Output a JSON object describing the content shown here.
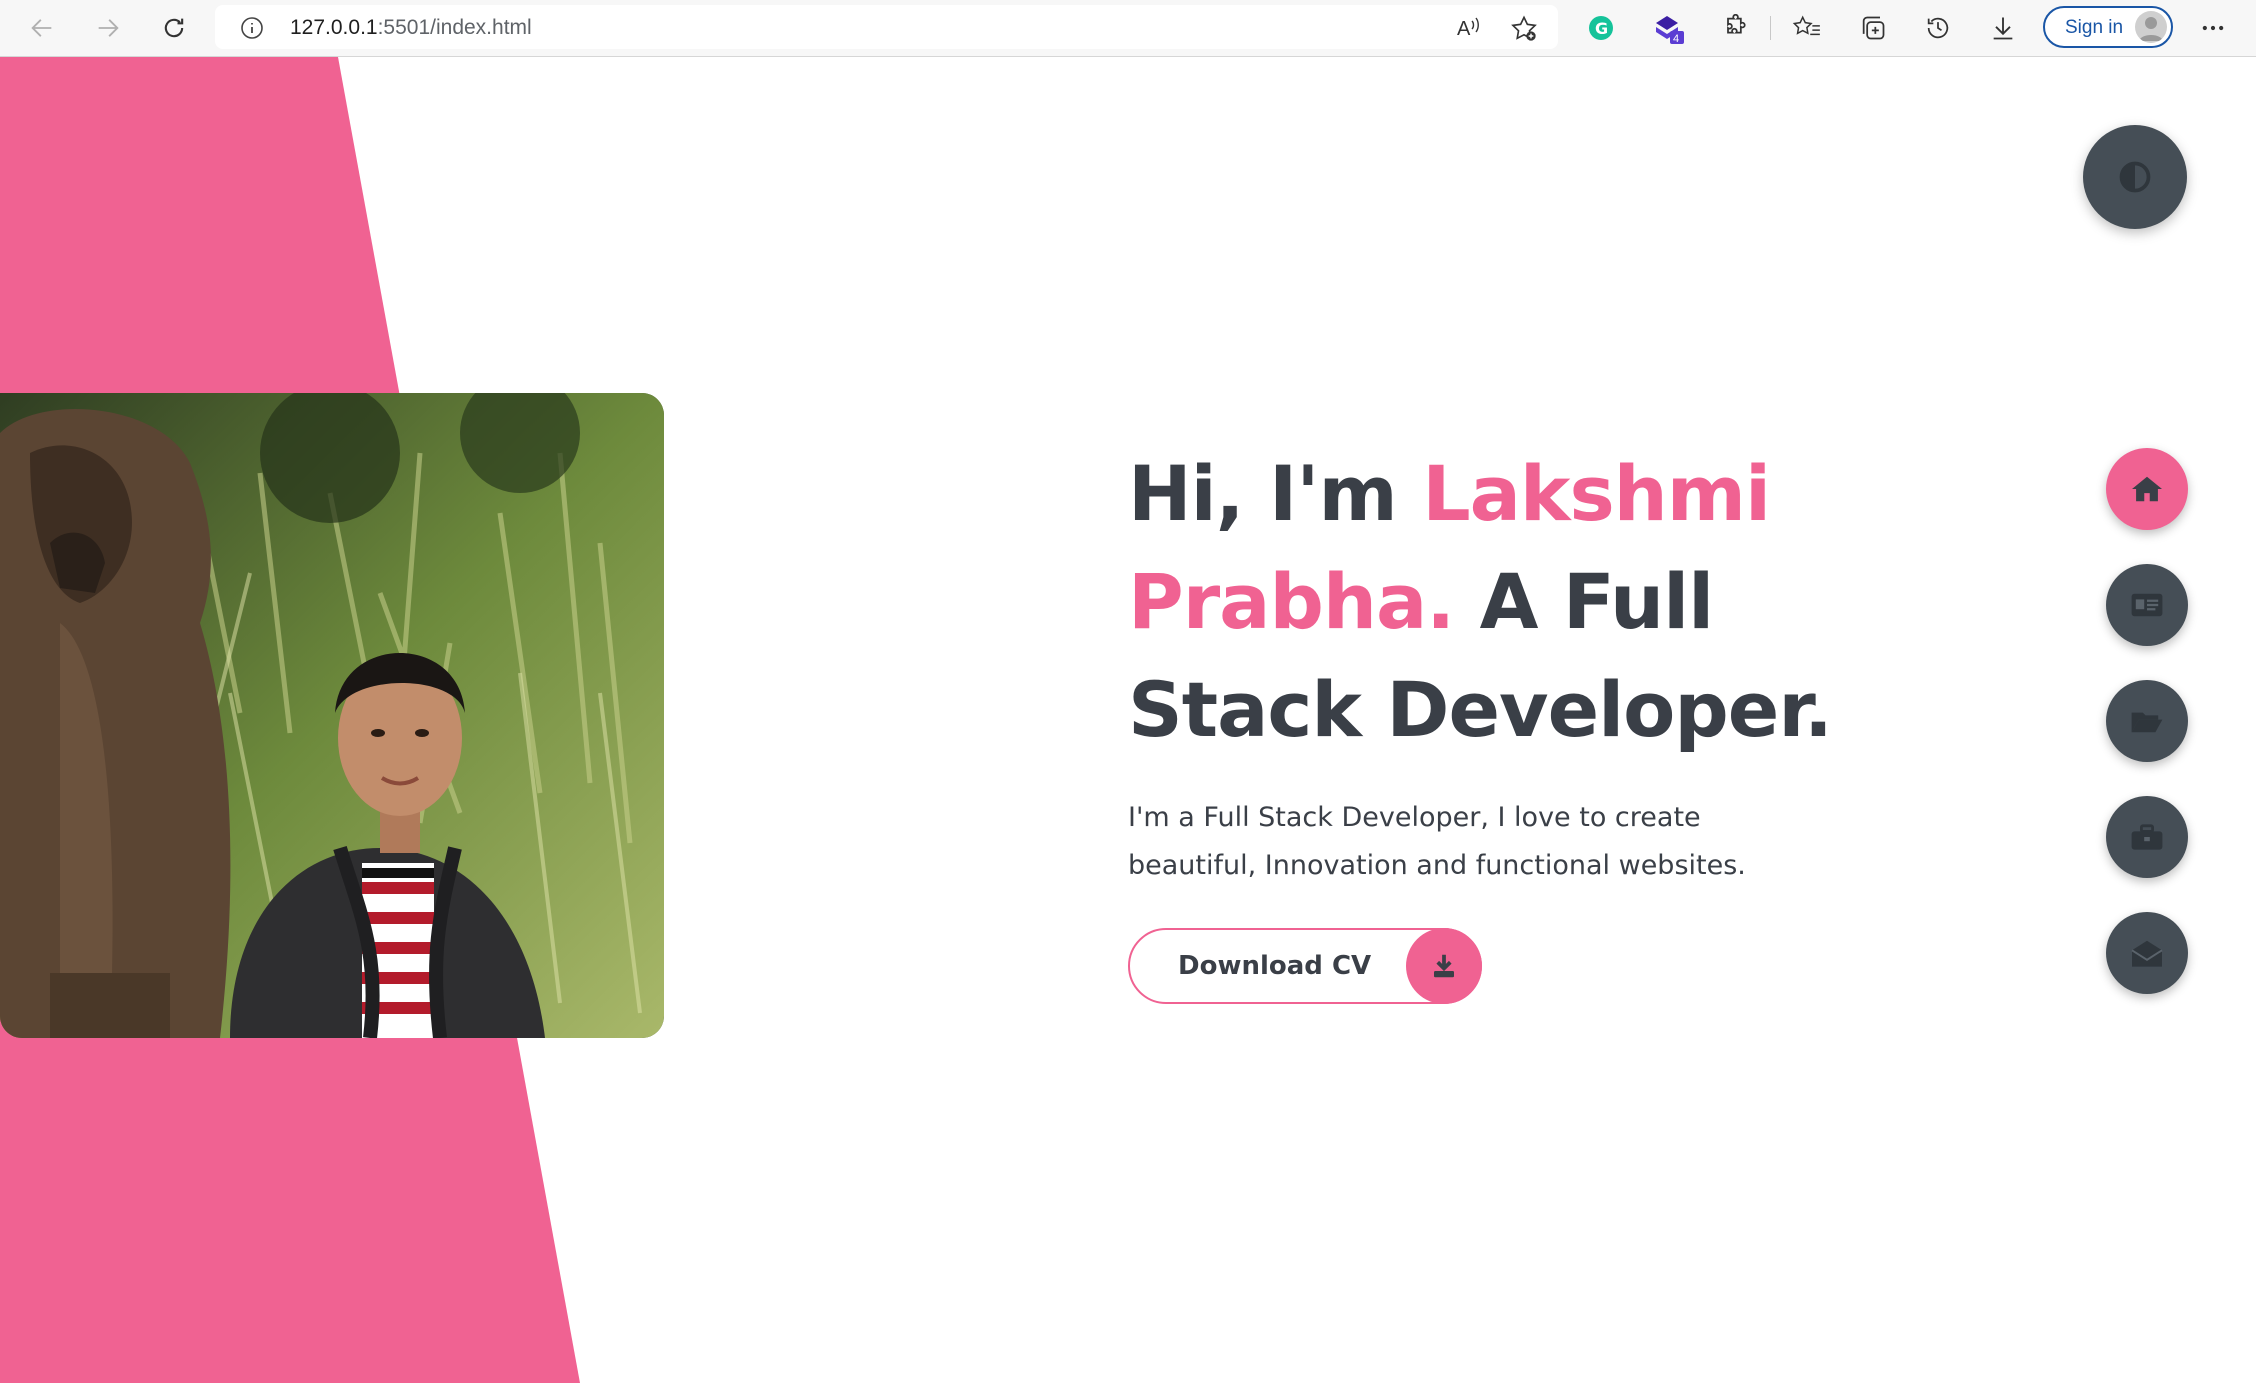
{
  "browser": {
    "url_prefix": "127.0.0.1",
    "url_rest": ":5501/index.html",
    "extension_badge": "4",
    "signin_label": "Sign in",
    "icons": [
      "back-arrow-icon",
      "forward-arrow-icon",
      "refresh-icon",
      "info-icon",
      "read-aloud-icon",
      "add-favorite-icon",
      "grammarly-icon",
      "extension-icon",
      "puzzle-icon",
      "favorites-icon",
      "collections-icon",
      "history-icon",
      "download-icon",
      "more-icon"
    ]
  },
  "hero": {
    "greeting": "Hi, I'm ",
    "name": "Lakshmi Prabha.",
    "tagline": " A Full Stack Developer.",
    "description": "I'm a Full Stack Developer, I love to create beautiful, Innovation and functional websites.",
    "cta_label": "Download CV"
  },
  "side_nav": {
    "items": [
      {
        "name": "home",
        "icon": "home-icon",
        "active": true
      },
      {
        "name": "about",
        "icon": "id-card-icon",
        "active": false
      },
      {
        "name": "portfolio",
        "icon": "folder-open-icon",
        "active": false
      },
      {
        "name": "experience",
        "icon": "briefcase-icon",
        "active": false
      },
      {
        "name": "contact",
        "icon": "envelope-open-icon",
        "active": false
      }
    ]
  },
  "theme_toggle": {
    "icon": "adjust-icon"
  },
  "colors": {
    "accent": "#f06292",
    "dark": "#3a3f47",
    "button_dark": "#454e56"
  }
}
